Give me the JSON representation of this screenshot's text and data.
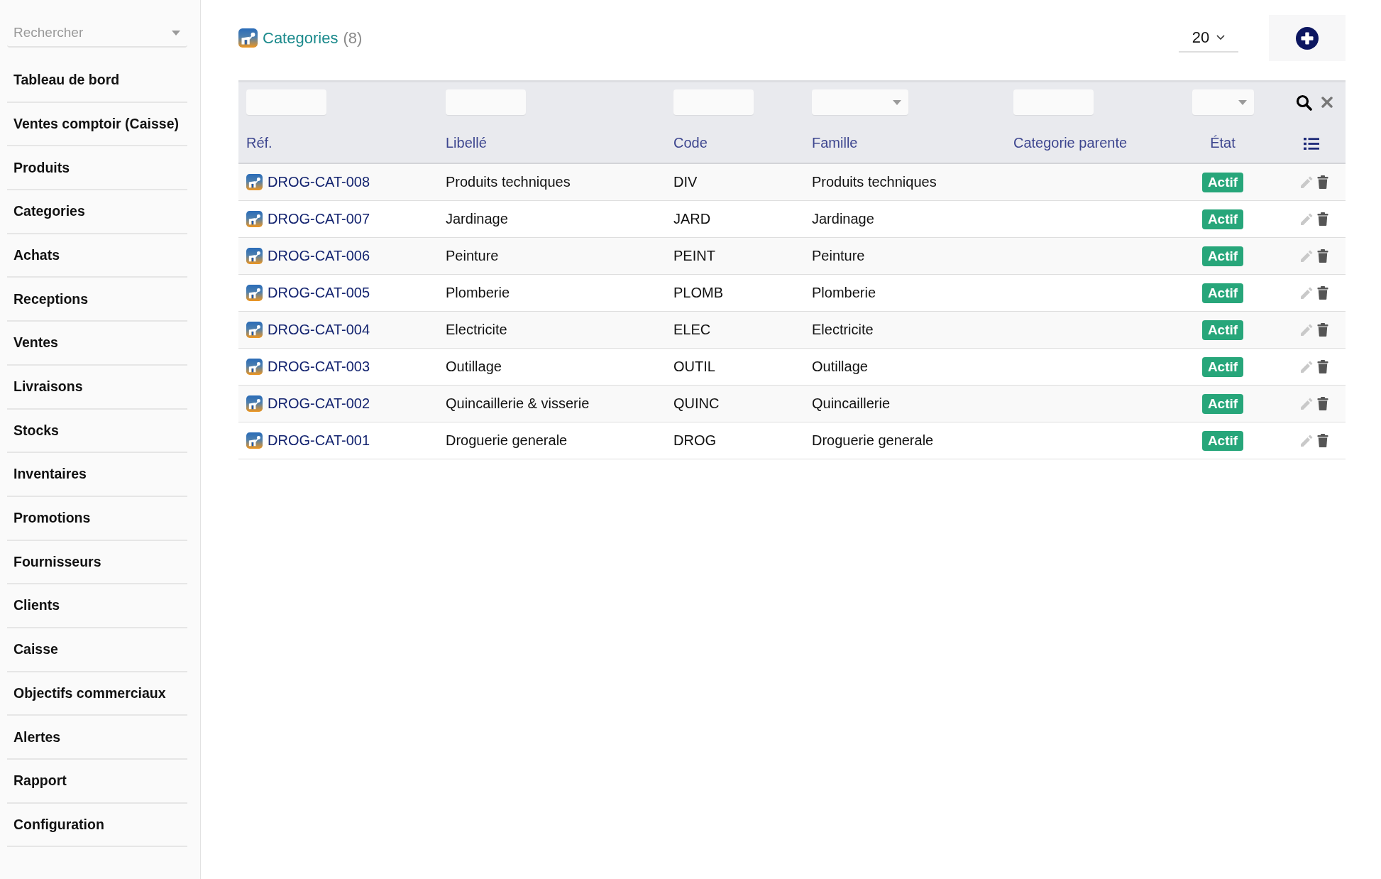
{
  "sidebar": {
    "search": {
      "placeholder": "Rechercher"
    },
    "items": [
      "Tableau de bord",
      "Ventes comptoir (Caisse)",
      "Produits",
      "Categories",
      "Achats",
      "Receptions",
      "Ventes",
      "Livraisons",
      "Stocks",
      "Inventaires",
      "Promotions",
      "Fournisseurs",
      "Clients",
      "Caisse",
      "Objectifs commerciaux",
      "Alertes",
      "Rapport",
      "Configuration"
    ]
  },
  "header": {
    "title": "Categories",
    "count": "(8)",
    "page_size": "20"
  },
  "table": {
    "filters": [
      {
        "kind": "text"
      },
      {
        "kind": "text"
      },
      {
        "kind": "text"
      },
      {
        "kind": "select"
      },
      {
        "kind": "text"
      },
      {
        "kind": "select"
      }
    ],
    "columns": [
      "Réf.",
      "Libellé",
      "Code",
      "Famille",
      "Categorie parente",
      "État"
    ],
    "rows": [
      {
        "ref": "DROG-CAT-008",
        "libelle": "Produits techniques",
        "code": "DIV",
        "famille": "Produits techniques",
        "etat": "Actif"
      },
      {
        "ref": "DROG-CAT-007",
        "libelle": "Jardinage",
        "code": "JARD",
        "famille": "Jardinage",
        "etat": "Actif"
      },
      {
        "ref": "DROG-CAT-006",
        "libelle": "Peinture",
        "code": "PEINT",
        "famille": "Peinture",
        "etat": "Actif"
      },
      {
        "ref": "DROG-CAT-005",
        "libelle": "Plomberie",
        "code": "PLOMB",
        "famille": "Plomberie",
        "etat": "Actif"
      },
      {
        "ref": "DROG-CAT-004",
        "libelle": "Electricite",
        "code": "ELEC",
        "famille": "Electricite",
        "etat": "Actif"
      },
      {
        "ref": "DROG-CAT-003",
        "libelle": "Outillage",
        "code": "OUTIL",
        "famille": "Outillage",
        "etat": "Actif"
      },
      {
        "ref": "DROG-CAT-002",
        "libelle": "Quincaillerie & visserie",
        "code": "QUINC",
        "famille": "Quincaillerie",
        "etat": "Actif"
      },
      {
        "ref": "DROG-CAT-001",
        "libelle": "Droguerie generale",
        "code": "DROG",
        "famille": "Droguerie generale",
        "etat": "Actif"
      }
    ]
  }
}
